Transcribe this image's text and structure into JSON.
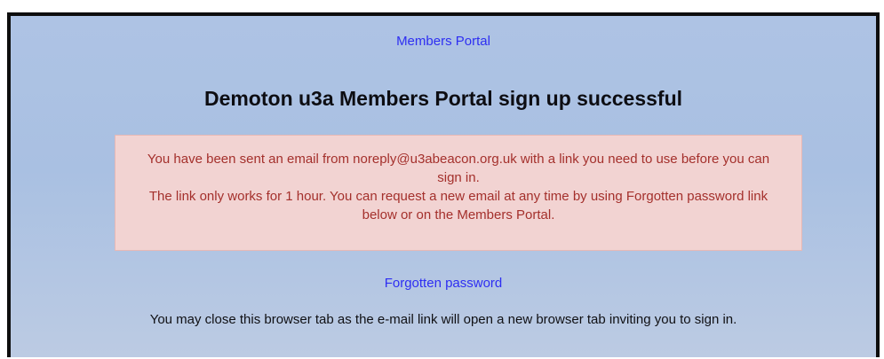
{
  "nav": {
    "portal_link": "Members Portal"
  },
  "page": {
    "title": "Demoton u3a Members Portal sign up successful"
  },
  "notice": {
    "line1": "You have been sent an email from noreply@u3abeacon.org.uk with a link you need to use before you can sign in.",
    "line2": "The link only works for 1 hour. You can request a new email at any time by using Forgotten password link below or on the Members Portal."
  },
  "links": {
    "forgotten_password": "Forgotten password"
  },
  "footer": {
    "close_note": "You may close this browser tab as the e-mail link will open a new browser tab inviting you to sign in."
  },
  "colors": {
    "background": "#aec3e4",
    "link": "#2e2ef2",
    "notice_bg": "#f2d3d2",
    "notice_text": "#a4302c"
  }
}
